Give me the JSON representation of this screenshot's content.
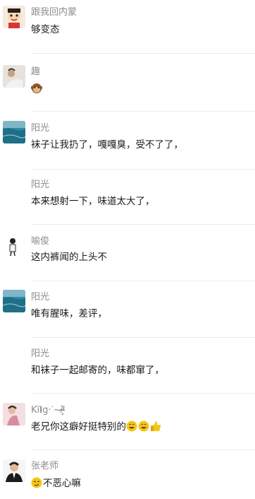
{
  "comments": [
    {
      "name": "跟我回内蒙",
      "text": "够变态",
      "avatar_icon": "cartoon-boy-avatar"
    },
    {
      "name": "趣",
      "text": "",
      "emoji": "monkey-face-emoji",
      "avatar_icon": "person-lying-avatar"
    },
    {
      "name": "阳光",
      "text": "袜子让我扔了，嘎嘎臭，受不了了，",
      "avatar_icon": "sea-landscape-avatar"
    },
    {
      "name": "阳光",
      "text": "本来想射一下，味道太大了，",
      "avatar_icon": ""
    },
    {
      "name": "喻俊",
      "text": "这内裤闻的上头不",
      "avatar_icon": "figure-sketch-avatar"
    },
    {
      "name": "阳光",
      "text": "唯有腥味，差评，",
      "avatar_icon": "sea-landscape-avatar"
    },
    {
      "name": "阳光",
      "text": "和袜子一起邮寄的，味都窜了，",
      "avatar_icon": ""
    },
    {
      "name": "Kï𝐈g·ᐝ~ᵒ̴̶̷̥᷅",
      "text": "老兄你这癖好挺特别的",
      "emoji_after": [
        "grinning-face-emoji",
        "grinning-face-emoji",
        "thumbs-up-emoji"
      ],
      "avatar_icon": "pink-figure-avatar"
    },
    {
      "name": "张老师",
      "text": "不恶心嘛",
      "emoji_before": "smirk-face-emoji",
      "avatar_icon": "man-in-suit-avatar"
    }
  ]
}
